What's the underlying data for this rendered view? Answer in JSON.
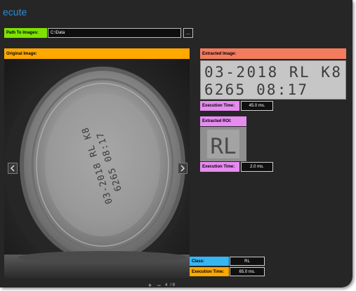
{
  "app": {
    "title": "ecute"
  },
  "path": {
    "label": "Path To Images:",
    "value": "C:\\Data",
    "browse_label": "..."
  },
  "original": {
    "label": "Original Image:"
  },
  "extracted_image": {
    "label": "Extracted Image:",
    "time_label": "Execution Time:",
    "time_value": "45.0 ms."
  },
  "extracted_roi": {
    "label": "Extracted ROI:",
    "time_label": "Execution Time:",
    "time_value": "2.0 ms."
  },
  "result": {
    "class_label": "Class:",
    "class_value": "RL",
    "time_label": "Execution Time:",
    "time_value": "65.0 ms."
  },
  "pager": {
    "zoom_in": "+",
    "zoom_out": "−",
    "current": "4",
    "total": "/ 9"
  },
  "icons": {
    "prev": "chevron-left-icon",
    "next": "chevron-right-icon"
  },
  "colors": {
    "path_label": "#7ee300",
    "original_label": "#ffa800",
    "extracted_label": "#f47c5e",
    "roi_label": "#e68bf0",
    "time_label": "#e68bf0",
    "class_label": "#37b6f2",
    "result_time_label": "#ffa800",
    "title": "#2a8fd8"
  }
}
